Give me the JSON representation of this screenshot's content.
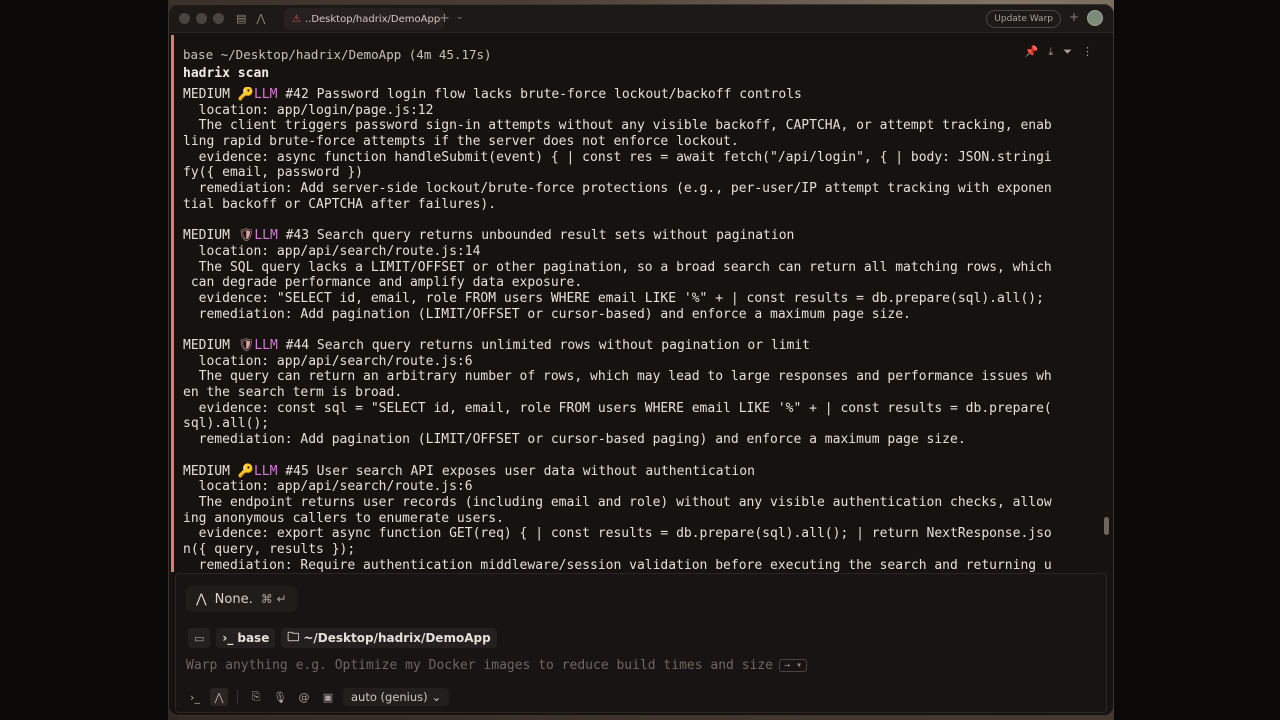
{
  "tab": {
    "title": "..Desktop/hadrix/DemoApp",
    "warn_icon": "warning-icon"
  },
  "titlebar": {
    "update_label": "Update Warp"
  },
  "block": {
    "meta": "base ~/Desktop/hadrix/DemoApp  (4m 45.17s)",
    "command": "hadrix scan"
  },
  "findings_lines": [
    {
      "pre": "MEDIUM ",
      "icon": "🔑",
      "tag": "LLM",
      "post": " #42 Password login flow lacks brute-force lockout/backoff controls"
    },
    {
      "text": "  location: app/login/page.js:12"
    },
    {
      "text": "  The client triggers password sign-in attempts without any visible backoff, CAPTCHA, or attempt tracking, enab"
    },
    {
      "text": "ling rapid brute-force attempts if the server does not enforce lockout."
    },
    {
      "text": "  evidence: async function handleSubmit(event) { | const res = await fetch(\"/api/login\", { | body: JSON.stringi"
    },
    {
      "text": "fy({ email, password })"
    },
    {
      "text": "  remediation: Add server-side lockout/brute-force protections (e.g., per-user/IP attempt tracking with exponen"
    },
    {
      "text": "tial backoff or CAPTCHA after failures)."
    },
    {
      "text": ""
    },
    {
      "pre": "MEDIUM ",
      "icon": "🛡",
      "tag": "LLM",
      "post": " #43 Search query returns unbounded result sets without pagination"
    },
    {
      "text": "  location: app/api/search/route.js:14"
    },
    {
      "text": "  The SQL query lacks a LIMIT/OFFSET or other pagination, so a broad search can return all matching rows, which"
    },
    {
      "text": " can degrade performance and amplify data exposure."
    },
    {
      "text": "  evidence: \"SELECT id, email, role FROM users WHERE email LIKE '%\" + | const results = db.prepare(sql).all();"
    },
    {
      "text": "  remediation: Add pagination (LIMIT/OFFSET or cursor-based) and enforce a maximum page size."
    },
    {
      "text": ""
    },
    {
      "pre": "MEDIUM ",
      "icon": "🛡",
      "tag": "LLM",
      "post": " #44 Search query returns unlimited rows without pagination or limit"
    },
    {
      "text": "  location: app/api/search/route.js:6"
    },
    {
      "text": "  The query can return an arbitrary number of rows, which may lead to large responses and performance issues wh"
    },
    {
      "text": "en the search term is broad."
    },
    {
      "text": "  evidence: const sql = \"SELECT id, email, role FROM users WHERE email LIKE '%\" + | const results = db.prepare("
    },
    {
      "text": "sql).all();"
    },
    {
      "text": "  remediation: Add pagination (LIMIT/OFFSET or cursor-based paging) and enforce a maximum page size."
    },
    {
      "text": ""
    },
    {
      "pre": "MEDIUM ",
      "icon": "🔑",
      "tag": "LLM",
      "post": " #45 User search API exposes user data without authentication"
    },
    {
      "text": "  location: app/api/search/route.js:6"
    },
    {
      "text": "  The endpoint returns user records (including email and role) without any visible authentication checks, allow"
    },
    {
      "text": "ing anonymous callers to enumerate users."
    },
    {
      "text": "  evidence: export async function GET(req) { | const results = db.prepare(sql).all(); | return NextResponse.jso"
    },
    {
      "text": "n({ query, results });"
    },
    {
      "text": "  remediation: Require authentication middleware/session validation before executing the search and returning u"
    }
  ],
  "suggestion": {
    "text": "None.",
    "shortcut": "⌘ ↵"
  },
  "context": {
    "env": "base",
    "path": "~/Desktop/hadrix/DemoApp"
  },
  "input": {
    "placeholder": "Warp anything e.g. Optimize my Docker images to reduce build times and size",
    "send_hint": "→ ▾"
  },
  "model": {
    "label": "auto (genius)"
  }
}
